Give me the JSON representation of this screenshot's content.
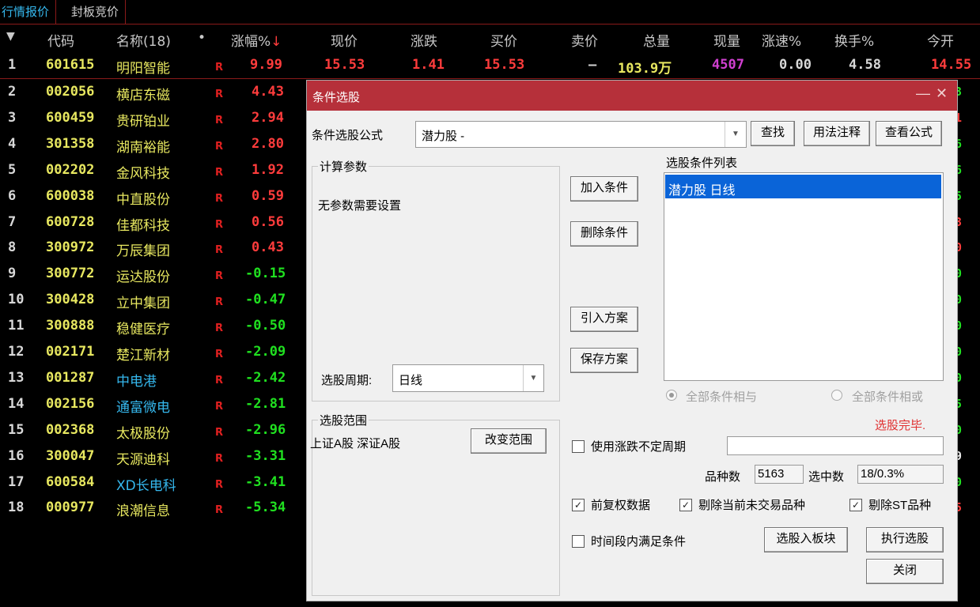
{
  "tabs": [
    "行情报价",
    "封板竞价"
  ],
  "columns": {
    "arrow": "▼",
    "code": "代码",
    "name": "名称(18)",
    "dot": "•",
    "pct": "涨幅%",
    "sortmark": "↓",
    "price": "现价",
    "change": "涨跌",
    "bid": "买价",
    "ask": "卖价",
    "vol": "总量",
    "cur": "现量",
    "speed": "涨速%",
    "turnover": "换手%",
    "open": "今开"
  },
  "first_row": {
    "idx": "1",
    "code": "601615",
    "name": "明阳智能",
    "flag": "R",
    "pct": "9.99",
    "price": "15.53",
    "change": "1.41",
    "bid": "15.53",
    "ask": "–",
    "vol": "103.9万",
    "cur": "4507",
    "speed": "0.00",
    "turnover": "4.58",
    "open": "14.55"
  },
  "rows": [
    {
      "idx": "2",
      "code": "002056",
      "name": "横店东磁",
      "flag": "R",
      "pct": "4.43",
      "edge": "3"
    },
    {
      "idx": "3",
      "code": "600459",
      "name": "贵研铂业",
      "flag": "R",
      "pct": "2.94",
      "edge": "1"
    },
    {
      "idx": "4",
      "code": "301358",
      "name": "湖南裕能",
      "flag": "R",
      "pct": "2.80",
      "edge": "6"
    },
    {
      "idx": "5",
      "code": "002202",
      "name": "金风科技",
      "flag": "R",
      "pct": "1.92",
      "edge": "6"
    },
    {
      "idx": "6",
      "code": "600038",
      "name": "中直股份",
      "flag": "R",
      "pct": "0.59",
      "edge": "5"
    },
    {
      "idx": "7",
      "code": "600728",
      "name": "佳都科技",
      "flag": "R",
      "pct": "0.56",
      "edge": "3"
    },
    {
      "idx": "8",
      "code": "300972",
      "name": "万辰集团",
      "flag": "R",
      "pct": "0.43",
      "edge": "0"
    },
    {
      "idx": "9",
      "code": "300772",
      "name": "运达股份",
      "flag": "R",
      "pct": "-0.15",
      "edge": "0"
    },
    {
      "idx": "10",
      "code": "300428",
      "name": "立中集团",
      "flag": "R",
      "pct": "-0.47",
      "edge": "0"
    },
    {
      "idx": "11",
      "code": "300888",
      "name": "稳健医疗",
      "flag": "R",
      "pct": "-0.50",
      "edge": "0"
    },
    {
      "idx": "12",
      "code": "002171",
      "name": "楚江新材",
      "flag": "R",
      "pct": "-2.09",
      "edge": "0"
    },
    {
      "idx": "13",
      "code": "001287",
      "name": "中电港",
      "flag": "R",
      "pct": "-2.42",
      "edge": "0"
    },
    {
      "idx": "14",
      "code": "002156",
      "name": "通富微电",
      "flag": "R",
      "pct": "-2.81",
      "edge": "5"
    },
    {
      "idx": "15",
      "code": "002368",
      "name": "太极股份",
      "flag": "R",
      "pct": "-2.96",
      "edge": "0"
    },
    {
      "idx": "16",
      "code": "300047",
      "name": "天源迪科",
      "flag": "R",
      "pct": "-3.31",
      "edge": "9"
    },
    {
      "idx": "17",
      "code": "600584",
      "name": "XD长电科",
      "flag": "R",
      "pct": "-3.41",
      "edge": "0"
    },
    {
      "idx": "18",
      "code": "000977",
      "name": "浪潮信息",
      "flag": "R",
      "pct": "-5.34",
      "edge": "5"
    }
  ],
  "dialog": {
    "title": "条件选股",
    "min": "—",
    "close": "✕",
    "formula_label": "条件选股公式",
    "formula_value": "潜力股  -",
    "find": "查找",
    "usage": "用法注释",
    "view_formula": "查看公式",
    "params_group": "计算参数",
    "no_params": "无参数需要设置",
    "period_label": "选股周期:",
    "period_value": "日线",
    "add_condition": "加入条件",
    "delete_condition": "删除条件",
    "import_scheme": "引入方案",
    "save_scheme": "保存方案",
    "list_title": "选股条件列表",
    "list_items": [
      "潜力股  日线"
    ],
    "radio_and": "全部条件相与",
    "radio_or": "全部条件相或",
    "status": "选股完毕.",
    "range_group": "选股范围",
    "range_value": "上证A股 深证A股",
    "change_range": "改变范围",
    "use_period": "使用涨跌不定周期",
    "count_label": "品种数",
    "count_value": "5163",
    "selected_label": "选中数",
    "selected_value": "18/0.3%",
    "pre_adjust": "前复权数据",
    "exclude_untraded": "剔除当前未交易品种",
    "exclude_st": "剔除ST品种",
    "time_satisfy": "时间段内满足条件",
    "to_block": "选股入板块",
    "execute": "执行选股",
    "close_btn": "关闭"
  },
  "colors": {
    "up": "#ff3c3c",
    "down": "#20e020",
    "code": "#e8e860",
    "accent": "#b6303a",
    "selected": "#0a64d8"
  }
}
